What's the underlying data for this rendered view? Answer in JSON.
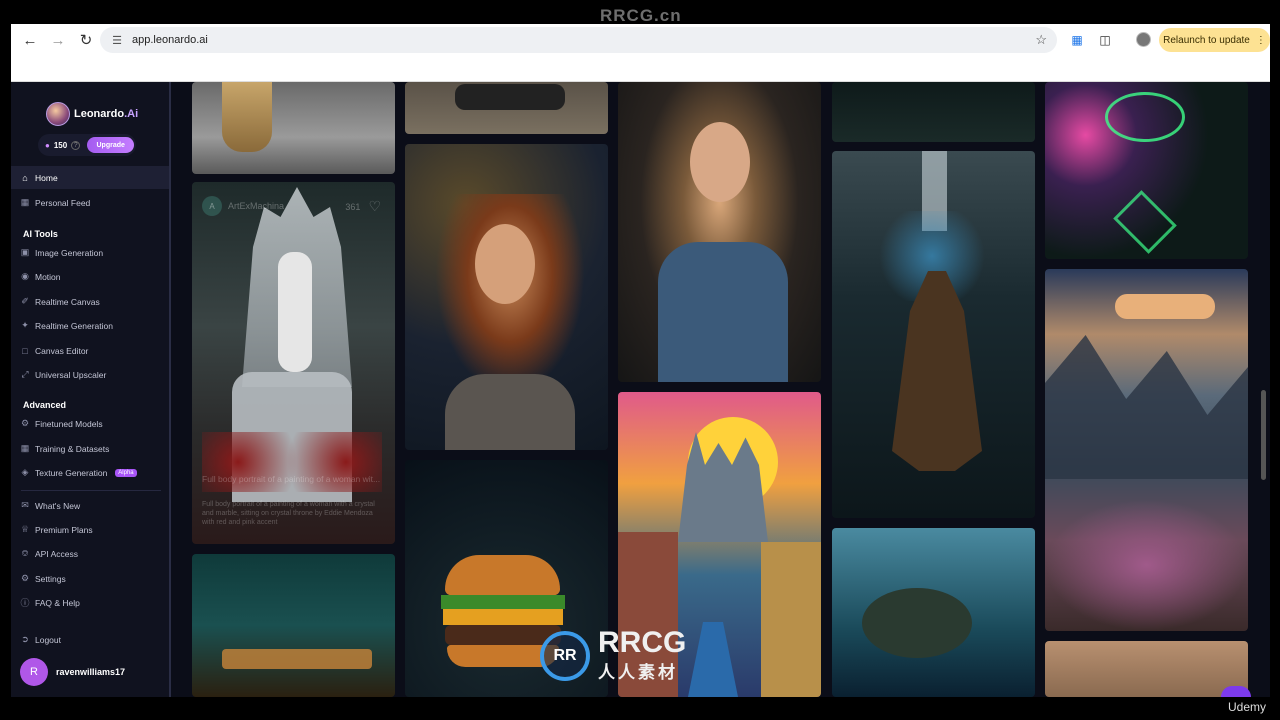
{
  "browser": {
    "url": "app.leonardo.ai",
    "relaunch_label": "Relaunch to update",
    "icons": [
      "back-icon",
      "forward-icon",
      "reload-icon",
      "site-info-icon",
      "bookmark-star-icon",
      "extension-icon",
      "puzzle-icon",
      "menu-icon"
    ]
  },
  "brand": {
    "name": "Leonardo",
    "suffix": ".Ai",
    "credits": "150",
    "upgrade_label": "Upgrade"
  },
  "sidebar": {
    "primary": [
      {
        "label": "Home",
        "icon": "home-icon"
      },
      {
        "label": "Personal Feed",
        "icon": "grid-icon"
      }
    ],
    "ai_tools_heading": "AI Tools",
    "ai_tools": [
      {
        "label": "Image Generation",
        "icon": "image-icon"
      },
      {
        "label": "Motion",
        "icon": "motion-icon"
      },
      {
        "label": "Realtime Canvas",
        "icon": "brush-icon"
      },
      {
        "label": "Realtime Generation",
        "icon": "sparkle-icon"
      },
      {
        "label": "Canvas Editor",
        "icon": "canvas-icon"
      },
      {
        "label": "Universal Upscaler",
        "icon": "upscale-icon"
      }
    ],
    "advanced_heading": "Advanced",
    "advanced": [
      {
        "label": "Finetuned Models",
        "icon": "model-icon"
      },
      {
        "label": "Training & Datasets",
        "icon": "dataset-icon"
      },
      {
        "label": "Texture Generation",
        "icon": "texture-icon",
        "badge": "Alpha"
      }
    ],
    "secondary": [
      {
        "label": "What's New",
        "icon": "megaphone-icon"
      },
      {
        "label": "Premium Plans",
        "icon": "crown-icon"
      },
      {
        "label": "API Access",
        "icon": "api-icon"
      },
      {
        "label": "Settings",
        "icon": "gear-icon"
      },
      {
        "label": "FAQ & Help",
        "icon": "help-icon"
      }
    ],
    "logout_label": "Logout",
    "user": {
      "initial": "R",
      "name": "ravenwilliams17"
    }
  },
  "gallery": {
    "featured": {
      "author": "ArtExMachina",
      "author_initial": "A",
      "likes": "361",
      "caption_title": "Full body portrait of a painting of a woman wit...",
      "caption_body": "Full body portrait of a painting of a woman with a crystal and marble, sitting on crystal throne by Eddie Mendoza with red and pink accent"
    }
  },
  "watermark": {
    "top": "RRCG.cn",
    "logo_mark": "RR",
    "logo_text": "RRCG",
    "logo_sub": "人人素材",
    "udemy": "Udemy"
  }
}
